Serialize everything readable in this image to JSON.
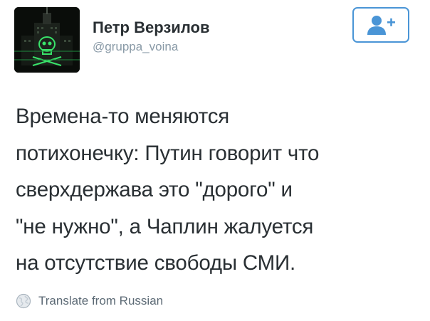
{
  "profile": {
    "display_name": "Петр Верзилов",
    "handle": "@gruppa_voina",
    "avatar_icon": "skull-crossbones-building-icon"
  },
  "follow_button": {
    "icon": "add-user-icon",
    "accent_color": "#4a95d6"
  },
  "tweet": {
    "lines": [
      "Времена-то меняются",
      "потихонечку: Путин говорит что",
      "сверхдержава это \"дорого\" и",
      "\"не нужно\", а Чаплин жалуется",
      "на отсутствие свободы СМИ."
    ]
  },
  "translate": {
    "icon": "globe-icon",
    "label": "Translate from Russian"
  }
}
